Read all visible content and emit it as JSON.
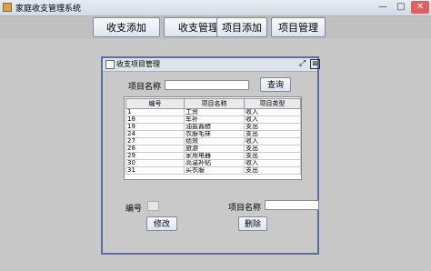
{
  "window": {
    "title": "家庭收支管理系统",
    "min_glyph": "—",
    "max_glyph": "□",
    "close_glyph": "✕"
  },
  "menu": [
    {
      "label": "收支添加"
    },
    {
      "label": "收支管理"
    },
    {
      "label": "项目添加"
    },
    {
      "label": "项目管理"
    }
  ],
  "frame": {
    "title": "收支项目管理",
    "restore_glyph": "⤢",
    "close_glyph": "⊠",
    "search_label": "项目名称",
    "search_value": "",
    "query_button": "查询",
    "table": {
      "columns": [
        "编号",
        "项目名称",
        "项目类型"
      ],
      "rows": [
        [
          "1",
          "工资",
          "收入"
        ],
        [
          "18",
          "车补",
          "收入"
        ],
        [
          "19",
          "油盐酱醋",
          "支出"
        ],
        [
          "24",
          "衣服毛袜",
          "支出"
        ],
        [
          "27",
          "绩效",
          "收入"
        ],
        [
          "28",
          "旅游",
          "支出"
        ],
        [
          "29",
          "家用电器",
          "支出"
        ],
        [
          "30",
          "高温补贴",
          "收入"
        ],
        [
          "31",
          "买衣服",
          "支出"
        ]
      ]
    },
    "id_label": "编号",
    "id_value": "",
    "name_label": "项目名称",
    "name_value": "",
    "modify_button": "修改",
    "delete_button": "删除"
  },
  "colors": {
    "frame_border": "#5a6fa5",
    "close": "#e06060"
  }
}
